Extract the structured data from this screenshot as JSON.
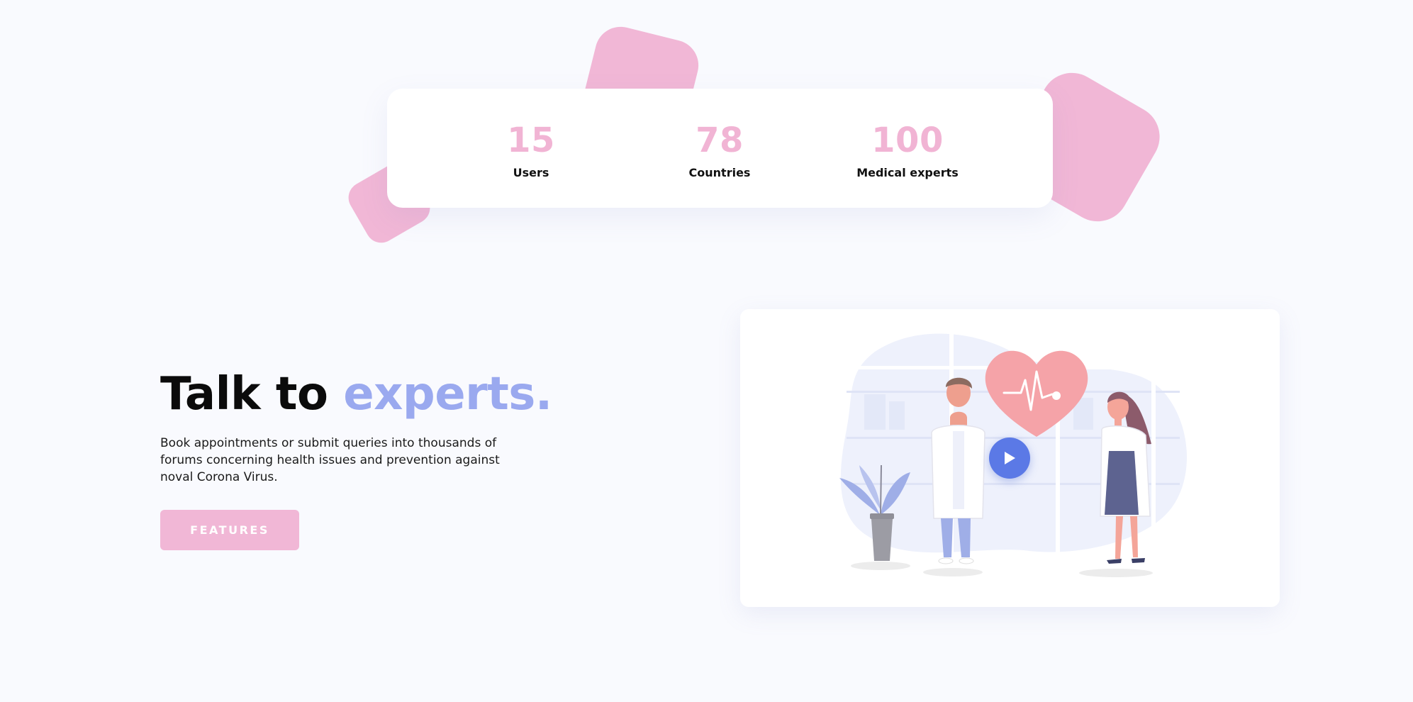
{
  "stats": [
    {
      "number": "15",
      "label": "Users"
    },
    {
      "number": "78",
      "label": "Countries"
    },
    {
      "number": "100",
      "label": "Medical experts"
    }
  ],
  "hero": {
    "title_main": "Talk to ",
    "title_accent": "experts.",
    "description": "Book appointments or submit queries into thousands of forums concerning health issues and prevention against noval Corona Virus.",
    "button_label": "FEATURES"
  },
  "video": {
    "illustration": "doctors-heart-illustration",
    "play_icon": "play-icon"
  },
  "colors": {
    "background": "#f9fafe",
    "pink_accent": "#f1b7d6",
    "blue_accent": "#9aa9ef",
    "play_button": "#5b79e6",
    "heart": "#f5a3a8"
  }
}
